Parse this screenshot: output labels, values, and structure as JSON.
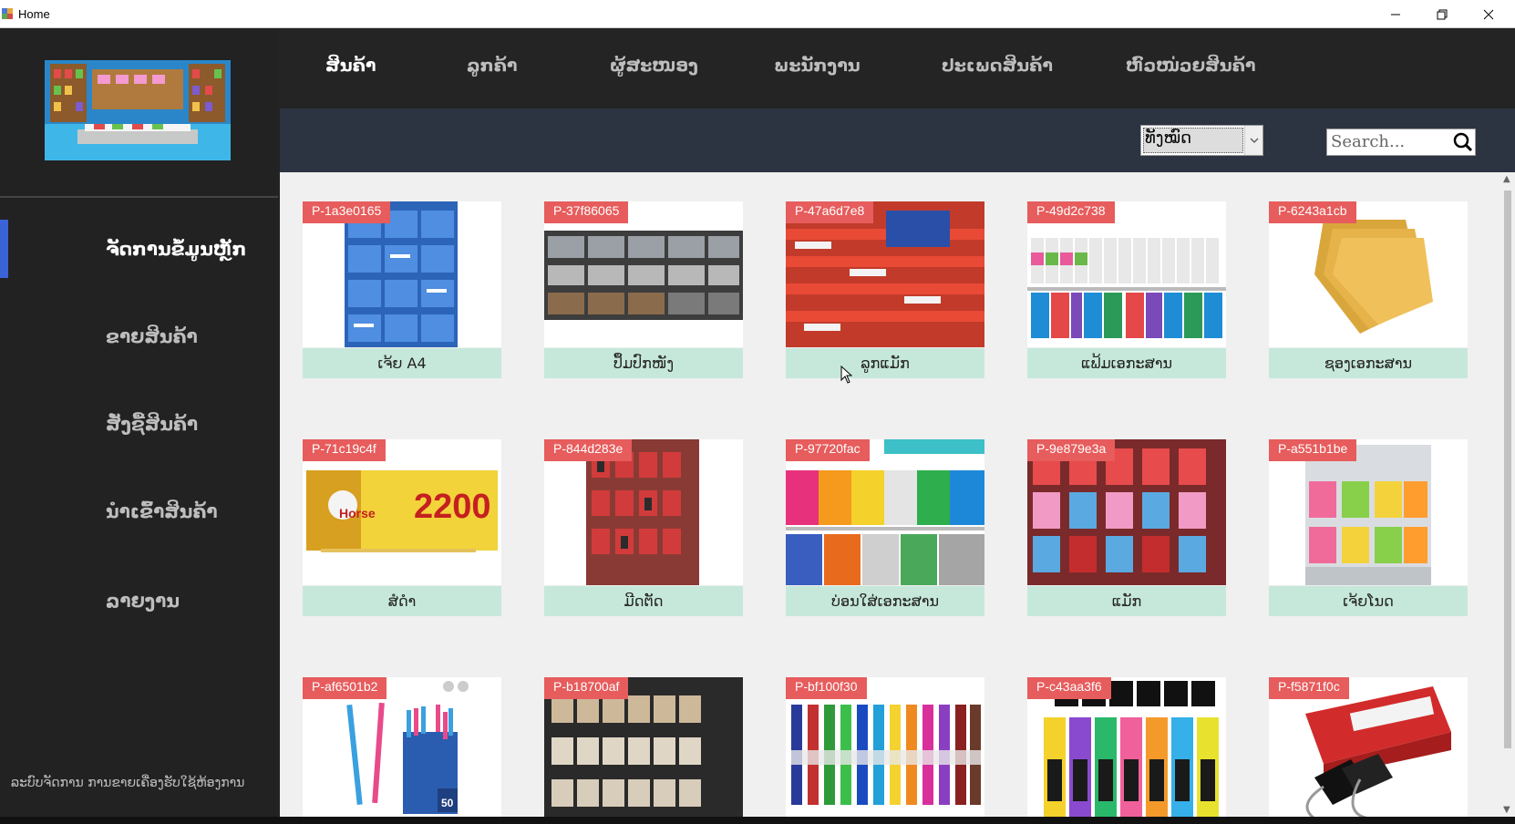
{
  "window": {
    "title": "Home",
    "controls": {
      "minimize": "minimize-icon",
      "maximize": "restore-icon",
      "close": "close-icon"
    }
  },
  "sidebar": {
    "items": [
      {
        "label": "ຈັດການຂໍ້ມູນຫຼັກ",
        "active": true
      },
      {
        "label": "ຂາຍສິນຄ້າ",
        "active": false
      },
      {
        "label": "ສັ່ງຊື້ສິນຄ້າ",
        "active": false
      },
      {
        "label": "ນຳເຂົ້າສິນຄ້າ",
        "active": false
      },
      {
        "label": "ລາຍງານ",
        "active": false
      }
    ],
    "footer": "ລະບົບຈັດການ ການຂາຍເຄື່ອງຮັບໃຊ້ຫ້ອງການ"
  },
  "topnav": {
    "tabs": [
      {
        "label": "ສິນຄ້າ",
        "active": true
      },
      {
        "label": "ລູກຄ້າ",
        "active": false
      },
      {
        "label": "ຜູ້ສະໜອງ",
        "active": false
      },
      {
        "label": "ພະນັກງານ",
        "active": false
      },
      {
        "label": "ປະເພດສິນຄ້າ",
        "active": false
      },
      {
        "label": "ຫົວໜ່ວຍສິນຄ້າ",
        "active": false
      }
    ]
  },
  "filter": {
    "category_selected": "ທັງໝົດ",
    "search_placeholder": "Search..."
  },
  "products": [
    {
      "code": "P-1a3e0165",
      "name": "ເຈ້ຍ A4",
      "image": "paper-boxes"
    },
    {
      "code": "P-37f86065",
      "name": "ປຶ້ມປົກໜັງ",
      "image": "notebooks-shelf"
    },
    {
      "code": "P-47a6d7e8",
      "name": "ລູກແມັກ",
      "image": "staple-boxes"
    },
    {
      "code": "P-49d2c738",
      "name": "ແຟ້ມເອກະສານ",
      "image": "binders"
    },
    {
      "code": "P-6243a1cb",
      "name": "ຊອງເອກະສານ",
      "image": "envelopes"
    },
    {
      "code": "P-71c19c4f",
      "name": "ສໍດຳ",
      "image": "pencil-box"
    },
    {
      "code": "P-844d283e",
      "name": "ມີດຕັດ",
      "image": "cutters"
    },
    {
      "code": "P-97720fac",
      "name": "ບ່ອນໃສ່ເອກະສານ",
      "image": "file-holders"
    },
    {
      "code": "P-9e879e3a",
      "name": "ແມັກ",
      "image": "staplers"
    },
    {
      "code": "P-a551b1be",
      "name": "ເຈ້ຍໂນດ",
      "image": "sticky-notes"
    },
    {
      "code": "P-af6501b2",
      "name": "",
      "image": "pens"
    },
    {
      "code": "P-b18700af",
      "name": "",
      "image": "tape-shelf"
    },
    {
      "code": "P-bf100f30",
      "name": "",
      "image": "markers"
    },
    {
      "code": "P-c43aa3f6",
      "name": "",
      "image": "highlighters"
    },
    {
      "code": "P-f5871f0c",
      "name": "",
      "image": "binder-clips"
    }
  ],
  "pencil_box_text": "2200",
  "pencil_brand": "Horse",
  "pens_count": "50",
  "colors": {
    "accent": "#3b63d8",
    "code_badge": "#e75c5c",
    "name_bar": "#c6e8da",
    "filter_bar": "#2c3442"
  }
}
